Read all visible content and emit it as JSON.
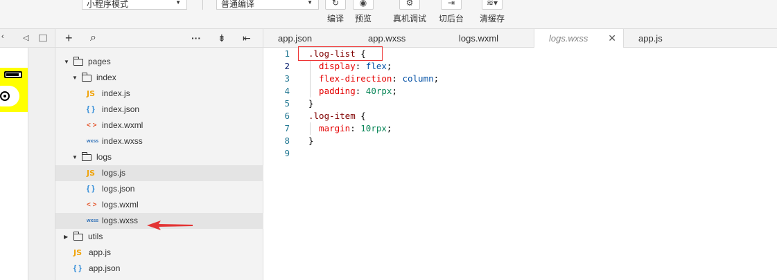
{
  "toolbar": {
    "mode_select": "小程序模式",
    "compile_select": "普通编译",
    "tools": [
      {
        "label": "编译",
        "icon": "refresh-icon",
        "glyph": "↻"
      },
      {
        "label": "预览",
        "icon": "eye-icon",
        "glyph": "◉"
      },
      {
        "label": "真机调试",
        "icon": "bug-icon",
        "glyph": "⚙"
      },
      {
        "label": "切后台",
        "icon": "switch-icon",
        "glyph": "⇥"
      },
      {
        "label": "清缓存",
        "icon": "layers-icon",
        "glyph": "≋▾"
      }
    ]
  },
  "explorer": {
    "header_buttons": {
      "add": "+",
      "search": "⌕",
      "more": "···",
      "sort": "⇟",
      "collapse": "⇤"
    },
    "tree": [
      {
        "label": "pages",
        "type": "folder",
        "depth": 0,
        "expanded": true
      },
      {
        "label": "index",
        "type": "folder",
        "depth": 1,
        "expanded": true
      },
      {
        "label": "index.js",
        "type": "js",
        "depth": 2
      },
      {
        "label": "index.json",
        "type": "json",
        "depth": 2
      },
      {
        "label": "index.wxml",
        "type": "wxml",
        "depth": 2
      },
      {
        "label": "index.wxss",
        "type": "wxss",
        "depth": 2
      },
      {
        "label": "logs",
        "type": "folder",
        "depth": 1,
        "expanded": true
      },
      {
        "label": "logs.js",
        "type": "js",
        "depth": 2,
        "selected": true
      },
      {
        "label": "logs.json",
        "type": "json",
        "depth": 2
      },
      {
        "label": "logs.wxml",
        "type": "wxml",
        "depth": 2
      },
      {
        "label": "logs.wxss",
        "type": "wxss",
        "depth": 2,
        "hover": true
      },
      {
        "label": "utils",
        "type": "folder",
        "depth": 0,
        "expanded": false
      },
      {
        "label": "app.js",
        "type": "js",
        "depth": 0
      },
      {
        "label": "app.json",
        "type": "json",
        "depth": 0
      }
    ],
    "icon_glyphs": {
      "js": "JS",
      "json": "{ }",
      "wxml": "< >",
      "wxss": "wxss"
    }
  },
  "editor": {
    "tabs": [
      {
        "label": "app.json",
        "active": false
      },
      {
        "label": "app.wxss",
        "active": false
      },
      {
        "label": "logs.wxml",
        "active": false
      },
      {
        "label": "logs.wxss",
        "active": true,
        "close": "✕"
      },
      {
        "label": "app.js",
        "active": false
      }
    ],
    "lines": [
      {
        "n": "1",
        "tokens": [
          {
            "t": ".log-list",
            "c": "sel-c"
          },
          {
            "t": " {",
            "c": "pun"
          }
        ]
      },
      {
        "n": "2",
        "current": true,
        "tokens": [
          {
            "t": "  display",
            "c": "prop"
          },
          {
            "t": ": ",
            "c": "pun"
          },
          {
            "t": "flex",
            "c": "val"
          },
          {
            "t": ";",
            "c": "pun"
          }
        ]
      },
      {
        "n": "3",
        "tokens": [
          {
            "t": "  flex-direction",
            "c": "prop"
          },
          {
            "t": ": ",
            "c": "pun"
          },
          {
            "t": "column",
            "c": "val"
          },
          {
            "t": ";",
            "c": "pun"
          }
        ]
      },
      {
        "n": "4",
        "tokens": [
          {
            "t": "  padding",
            "c": "prop"
          },
          {
            "t": ": ",
            "c": "pun"
          },
          {
            "t": "40rpx",
            "c": "num"
          },
          {
            "t": ";",
            "c": "pun"
          }
        ]
      },
      {
        "n": "5",
        "tokens": [
          {
            "t": "}",
            "c": "pun"
          }
        ]
      },
      {
        "n": "6",
        "tokens": [
          {
            "t": ".log-item",
            "c": "sel-c"
          },
          {
            "t": " {",
            "c": "pun"
          }
        ]
      },
      {
        "n": "7",
        "tokens": [
          {
            "t": "  margin",
            "c": "prop"
          },
          {
            "t": ": ",
            "c": "pun"
          },
          {
            "t": "10rpx",
            "c": "num"
          },
          {
            "t": ";",
            "c": "pun"
          }
        ]
      },
      {
        "n": "8",
        "tokens": [
          {
            "t": "}",
            "c": "pun"
          }
        ]
      },
      {
        "n": "9",
        "tokens": []
      }
    ]
  },
  "colors": {
    "annotation_red": "#e33333",
    "sim_yellow": "#ffff00"
  }
}
